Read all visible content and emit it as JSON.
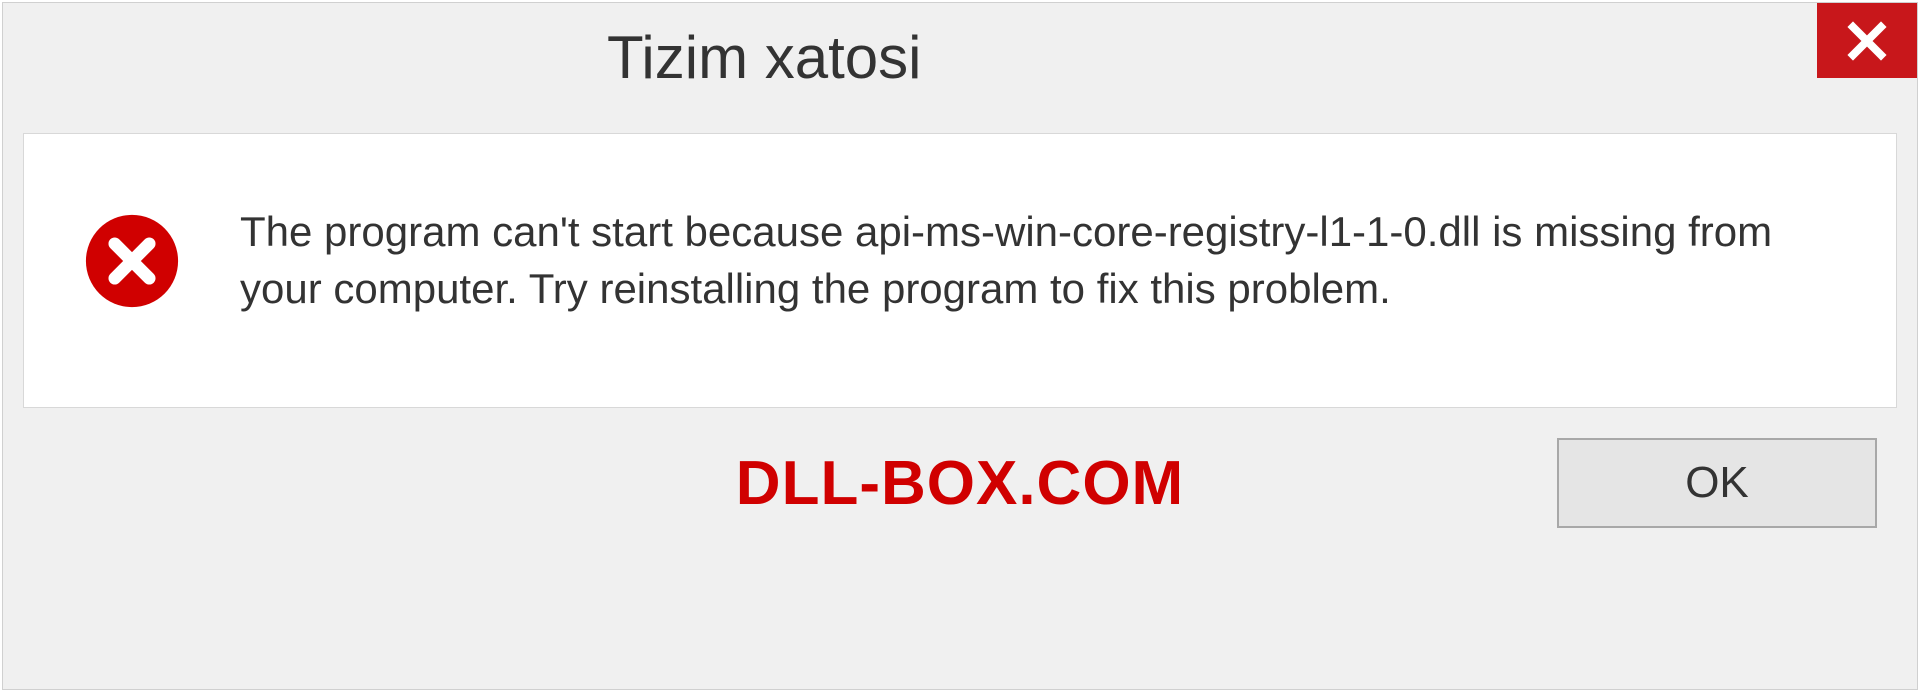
{
  "dialog": {
    "title": "Tizim xatosi",
    "message": "The program can't start because api-ms-win-core-registry-l1-1-0.dll is missing from your computer. Try reinstalling the program to fix this problem.",
    "ok_label": "OK",
    "watermark": "DLL-BOX.COM"
  }
}
